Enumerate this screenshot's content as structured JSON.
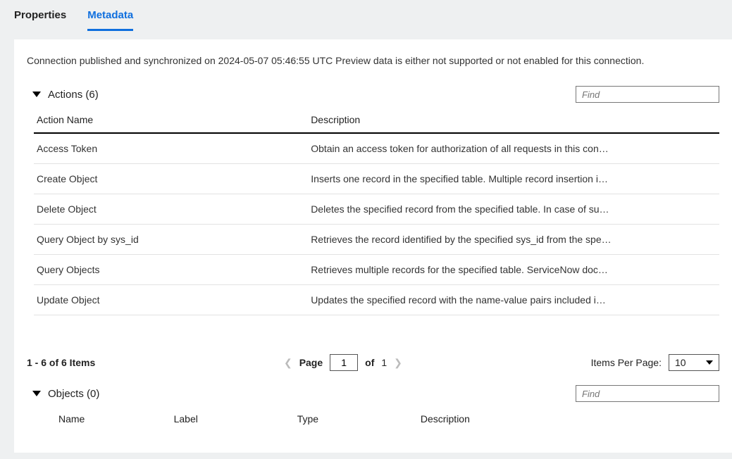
{
  "tabs": {
    "properties": "Properties",
    "metadata": "Metadata"
  },
  "status_text": "Connection published and synchronized on 2024-05-07 05:46:55 UTC Preview data is either not supported or not enabled for this connection.",
  "actions": {
    "title": "Actions (6)",
    "find_placeholder": "Find",
    "headers": {
      "name": "Action Name",
      "desc": "Description"
    },
    "rows": [
      {
        "name": "Access Token",
        "desc": "Obtain an access token for authorization of all requests in this con…"
      },
      {
        "name": "Create Object",
        "desc": "Inserts one record in the specified table. Multiple record insertion i…"
      },
      {
        "name": "Delete Object",
        "desc": "Deletes the specified record from the specified table. In case of su…"
      },
      {
        "name": "Query Object by sys_id",
        "desc": "Retrieves the record identified by the specified sys_id from the spe…"
      },
      {
        "name": "Query Objects",
        "desc": "Retrieves multiple records for the specified table. ServiceNow doc…"
      },
      {
        "name": "Update Object",
        "desc": "Updates the specified record with the name-value pairs included i…"
      }
    ]
  },
  "pager": {
    "range": "1 - 6 of 6 Items",
    "page_label": "Page",
    "page_value": "1",
    "of_label": "of",
    "total_pages": "1",
    "ipp_label": "Items Per Page:",
    "ipp_value": "10"
  },
  "objects": {
    "title": "Objects (0)",
    "find_placeholder": "Find",
    "headers": {
      "name": "Name",
      "label": "Label",
      "type": "Type",
      "desc": "Description"
    }
  }
}
